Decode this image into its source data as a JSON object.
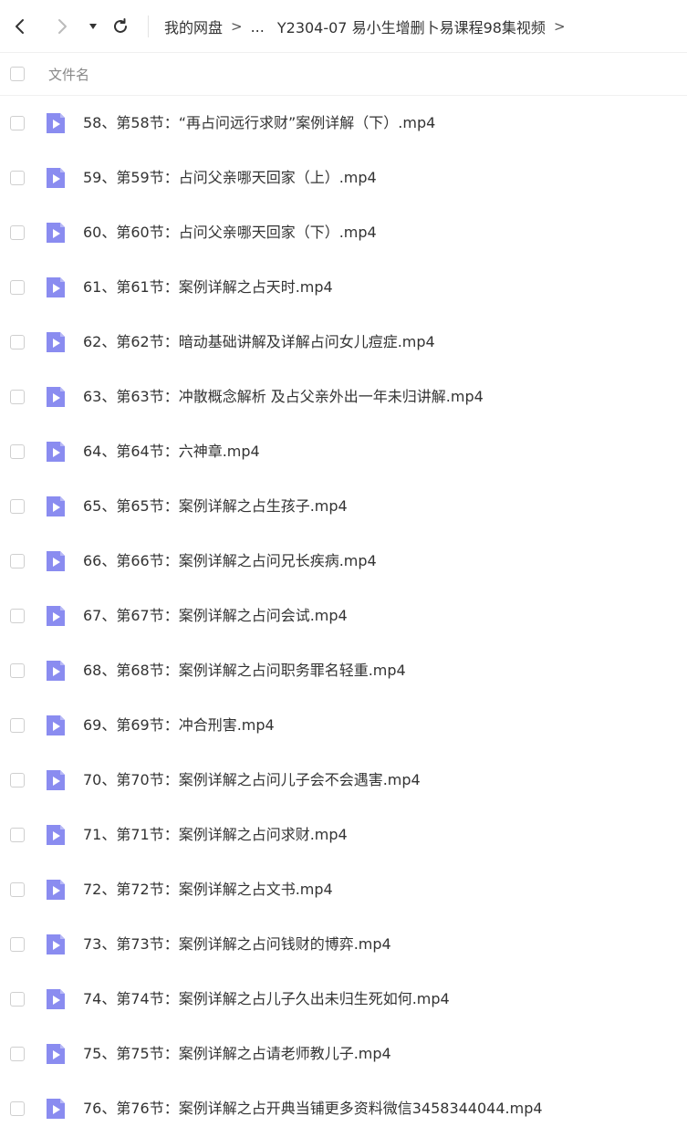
{
  "toolbar": {
    "back_icon": "chevron-left-icon",
    "forward_icon": "chevron-right-icon",
    "dropdown_icon": "caret-down-icon",
    "refresh_icon": "refresh-icon"
  },
  "breadcrumb": {
    "root": "我的网盘",
    "ellipsis": "...",
    "current": "Y2304-07 易小生增删卜易课程98集视频",
    "separator": ">"
  },
  "list_header": {
    "column_name": "文件名"
  },
  "files": [
    {
      "name": "58、第58节：“再占问远行求财”案例详解（下）.mp4"
    },
    {
      "name": "59、第59节：占问父亲哪天回家（上）.mp4"
    },
    {
      "name": "60、第60节：占问父亲哪天回家（下）.mp4"
    },
    {
      "name": "61、第61节：案例详解之占天时.mp4"
    },
    {
      "name": "62、第62节：暗动基础讲解及详解占问女儿痘症.mp4"
    },
    {
      "name": "63、第63节：冲散概念解析 及占父亲外出一年未归讲解.mp4"
    },
    {
      "name": "64、第64节：六神章.mp4"
    },
    {
      "name": "65、第65节：案例详解之占生孩子.mp4"
    },
    {
      "name": "66、第66节：案例详解之占问兄长疾病.mp4"
    },
    {
      "name": "67、第67节：案例详解之占问会试.mp4"
    },
    {
      "name": "68、第68节：案例详解之占问职务罪名轻重.mp4"
    },
    {
      "name": "69、第69节：冲合刑害.mp4"
    },
    {
      "name": "70、第70节：案例详解之占问儿子会不会遇害.mp4"
    },
    {
      "name": "71、第71节：案例详解之占问求财.mp4"
    },
    {
      "name": "72、第72节：案例详解之占文书.mp4"
    },
    {
      "name": "73、第73节：案例详解之占问钱财的博弈.mp4"
    },
    {
      "name": "74、第74节：案例详解之占儿子久出未归生死如何.mp4"
    },
    {
      "name": "75、第75节：案例详解之占请老师教儿子.mp4"
    },
    {
      "name": "76、第76节：案例详解之占开典当铺更多资料微信3458344044.mp4"
    }
  ],
  "colors": {
    "video_icon": "#8a8cf0",
    "text": "#333333",
    "muted": "#888888"
  }
}
